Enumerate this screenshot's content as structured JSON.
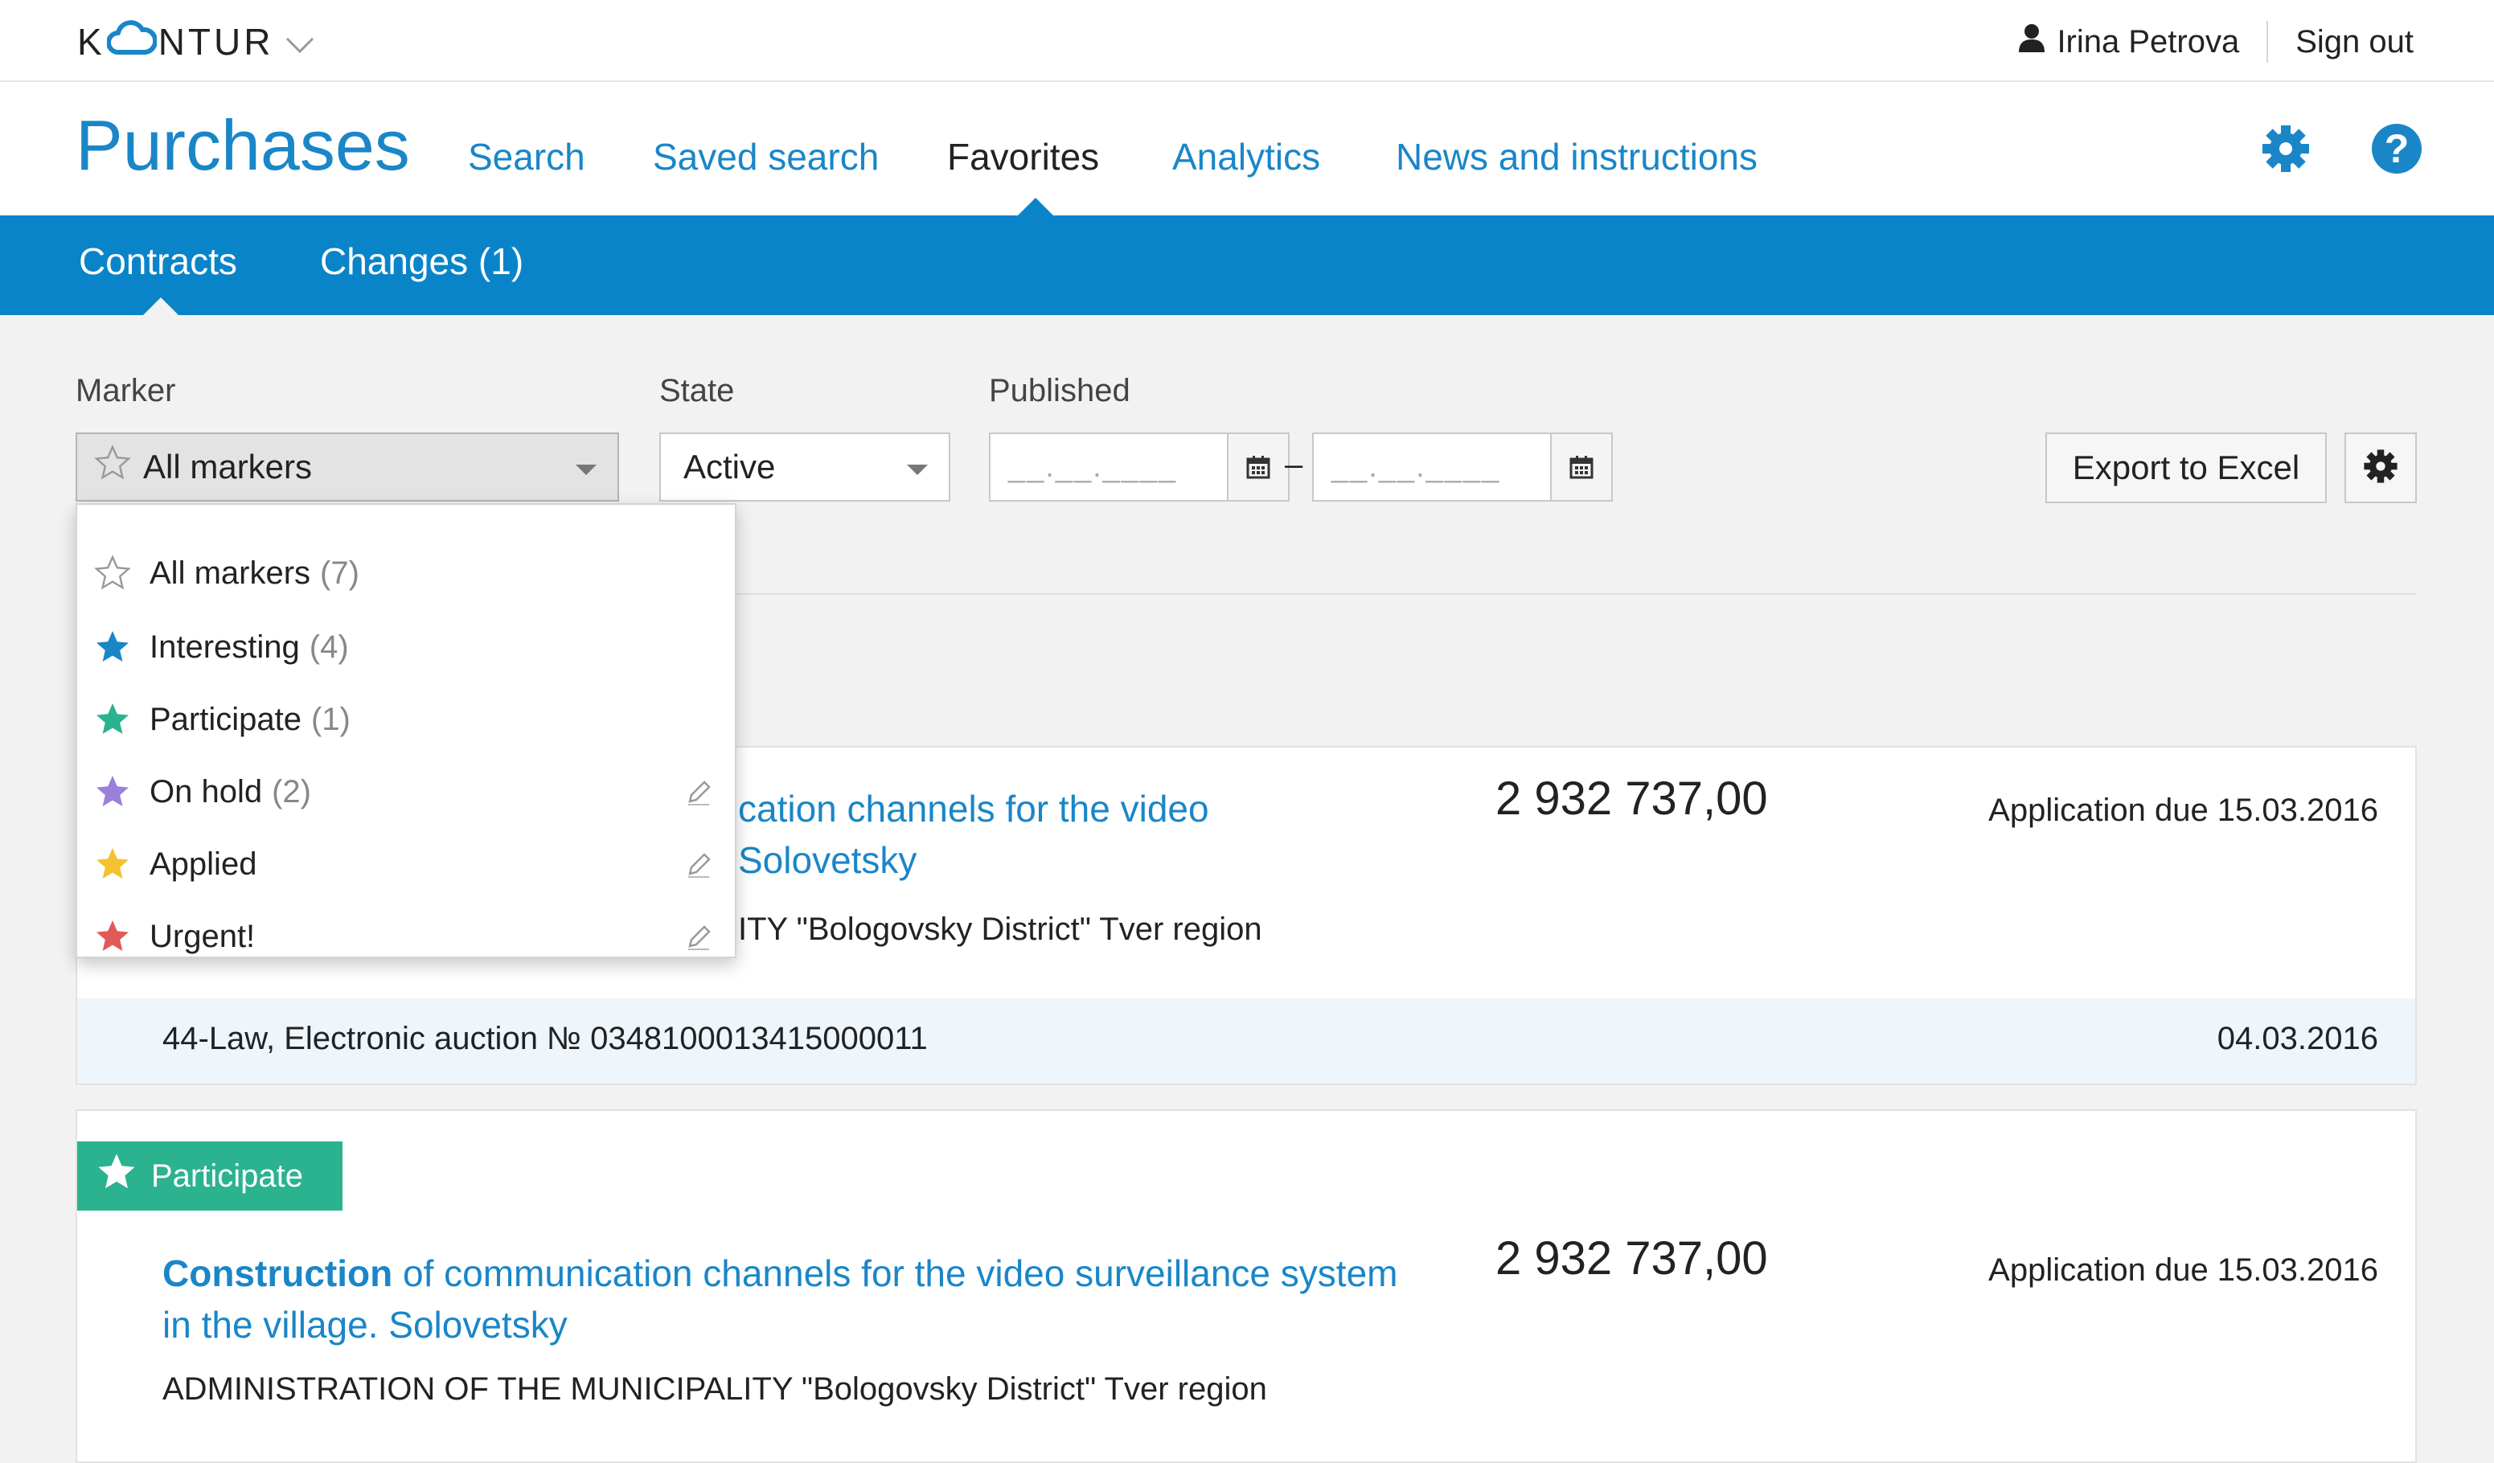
{
  "topbar": {
    "logo_left": "K",
    "logo_right": "NTUR",
    "user_name": "Irina Petrova",
    "sign_out": "Sign out"
  },
  "nav": {
    "app_title": "Purchases",
    "links": [
      "Search",
      "Saved search",
      "Favorites",
      "Analytics",
      "News and instructions"
    ],
    "active": "Favorites"
  },
  "subnav": {
    "tabs": [
      "Contracts",
      "Changes (1)"
    ],
    "active": "Contracts"
  },
  "filters": {
    "marker_label": "Marker",
    "marker_value": "All markers",
    "state_label": "State",
    "state_value": "Active",
    "published_label": "Published",
    "date_from_placeholder": "__.__.____",
    "date_to_placeholder": "__.__.____",
    "date_separator": "–",
    "export_label": "Export to Excel"
  },
  "marker_menu": {
    "items": [
      {
        "label": "All markers",
        "count": "(7)",
        "color": "none",
        "editable": false
      },
      {
        "label": "Interesting",
        "count": "(4)",
        "color": "#1a86c8",
        "editable": false
      },
      {
        "label": "Participate",
        "count": "(1)",
        "color": "#2bb28e",
        "editable": false
      },
      {
        "label": "On hold",
        "count": "(2)",
        "color": "#9b7fd8",
        "editable": true
      },
      {
        "label": "Applied",
        "count": "",
        "color": "#f2c230",
        "editable": true
      },
      {
        "label": "Urgent!",
        "count": "",
        "color": "#e05a5a",
        "editable": true
      }
    ]
  },
  "cards": [
    {
      "title_line1_visible": "cation channels for the video",
      "title_line2_visible": "Solovetsky",
      "org_visible": "ITY \"Bologovsky District\" Tver region",
      "price": "2 932 737,00",
      "due": "Application due 15.03.2016",
      "law": "44-Law, Electronic auction № 0348100013415000011",
      "published": "04.03.2016"
    },
    {
      "badge": "Participate",
      "badge_color": "#2bb28e",
      "title_bold": "Construction",
      "title_rest": " of communication channels for the video surveillance system in the village. Solovetsky",
      "org": "ADMINISTRATION OF THE MUNICIPALITY \"Bologovsky District\" Tver region",
      "price": "2 932 737,00",
      "due": "Application due 15.03.2016"
    }
  ],
  "colors": {
    "accent": "#1a86c8",
    "subnav_bg": "#0a84c9",
    "participate": "#2bb28e"
  }
}
